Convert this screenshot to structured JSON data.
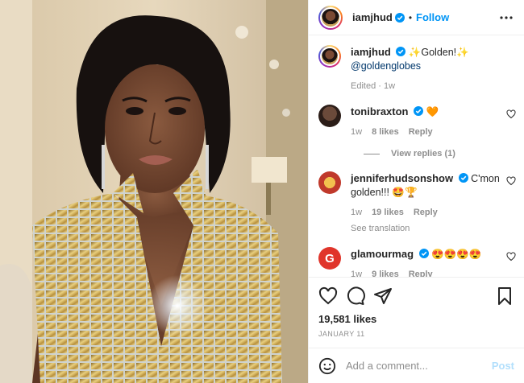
{
  "header": {
    "username": "iamjhud",
    "separator": "•",
    "follow_label": "Follow",
    "more_icon": "more-horizontal-icon"
  },
  "caption": {
    "username": "iamjhud",
    "text": "✨Golden!✨",
    "mention": "@goldenglobes",
    "edited": "Edited · 1w"
  },
  "comments": [
    {
      "username": "tonibraxton",
      "text": "🧡",
      "time": "1w",
      "likes": "8 likes",
      "reply": "Reply",
      "view_replies": "View replies (1)"
    },
    {
      "username": "jenniferhudsonshow",
      "text": "C'mon golden!!! 🤩🏆",
      "time": "1w",
      "likes": "19 likes",
      "reply": "Reply",
      "see_translation": "See translation"
    },
    {
      "username": "glamourmag",
      "text": "😍😍😍😍",
      "time": "1w",
      "likes": "9 likes",
      "reply": "Reply"
    }
  ],
  "actions": {
    "like_icon": "heart-icon",
    "comment_icon": "comment-icon",
    "share_icon": "send-icon",
    "save_icon": "bookmark-icon"
  },
  "likes": "19,581 likes",
  "date": "JANUARY 11",
  "composer": {
    "placeholder": "Add a comment...",
    "post_label": "Post",
    "emoji_icon": "emoji-icon"
  },
  "colors": {
    "accent": "#0095f6",
    "muted": "#8e8e8e",
    "post_disabled": "#b2dffc",
    "gold": "#c9a54a"
  }
}
